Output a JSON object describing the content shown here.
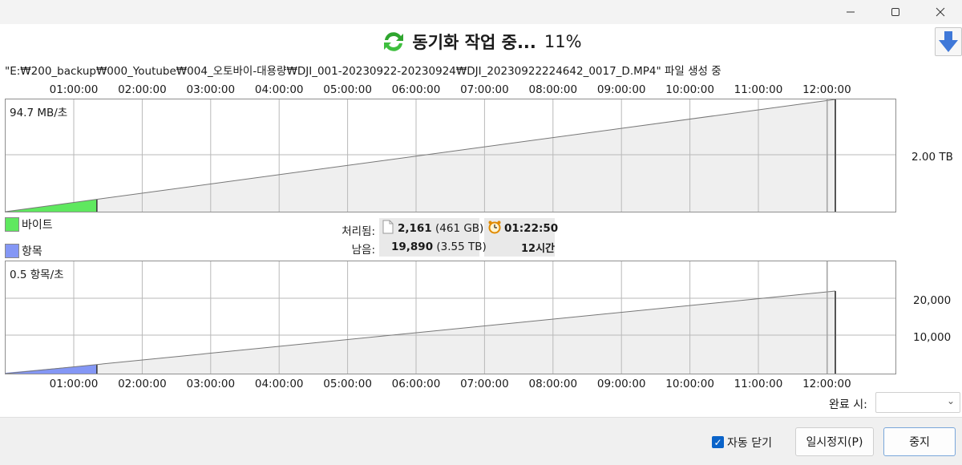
{
  "window": {
    "minimize_icon": "minimize-icon",
    "maximize_icon": "maximize-icon",
    "close_icon": "close-icon"
  },
  "header": {
    "title": "동기화 작업 중...",
    "percent": "11%",
    "icon": "sync-icon",
    "collapse_icon": "arrow-down-icon"
  },
  "status_text": "\"E:₩200_backup₩000_Youtube₩004_오토바이-대용량₩DJI_001-20230922-20230924₩DJI_20230922224642_0017_D.MP4\" 파일 생성 중",
  "time_ticks": [
    "01:00:00",
    "02:00:00",
    "03:00:00",
    "04:00:00",
    "05:00:00",
    "06:00:00",
    "07:00:00",
    "08:00:00",
    "09:00:00",
    "10:00:00",
    "11:00:00",
    "12:00:00"
  ],
  "bytes_graph": {
    "rate": "94.7 MB/초",
    "right_label": "2.00 TB",
    "legend": "바이트",
    "fill_color": "#5fe85f",
    "progress": 0.11
  },
  "items_graph": {
    "rate": "0.5 항목/초",
    "right_labels": [
      "20,000",
      "10,000"
    ],
    "legend": "항목",
    "fill_color": "#8497f5",
    "progress": 0.11
  },
  "stats": {
    "processed_label": "처리됨:",
    "remaining_label": "남음:",
    "processed_count": "2,161",
    "processed_size": "(461 GB)",
    "remaining_count": "19,890",
    "remaining_size": "(3.55 TB)",
    "elapsed": "01:22:50",
    "remaining_time": "12시간",
    "file_icon": "file-icon",
    "clock_icon": "alarm-clock-icon"
  },
  "on_complete": {
    "label": "완료 시:",
    "value": "",
    "dropdown_icon": "chevron-down-icon"
  },
  "footer": {
    "auto_close_label": "자동 닫기",
    "auto_close_checked": true,
    "pause_label": "일시정지(P)",
    "stop_label": "중지"
  }
}
